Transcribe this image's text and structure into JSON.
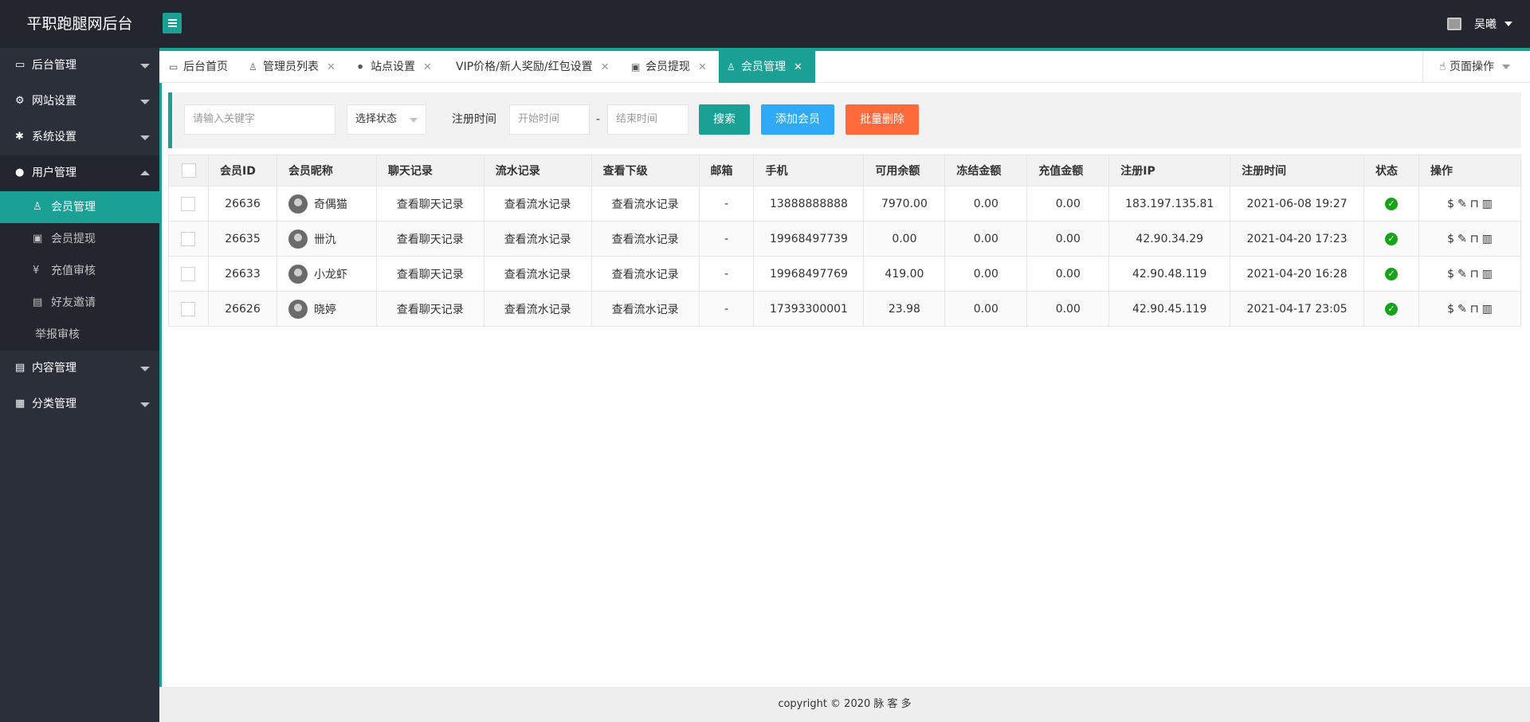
{
  "header": {
    "logo": "平职跑腿网后台",
    "user_name": "吴曦"
  },
  "sidebar": {
    "items": [
      {
        "label": "后台管理",
        "icon": "monitor-icon"
      },
      {
        "label": "网站设置",
        "icon": "gears-icon"
      },
      {
        "label": "系统设置",
        "icon": "gear-icon"
      },
      {
        "label": "用户管理",
        "icon": "users-icon"
      },
      {
        "label": "内容管理",
        "icon": "document-icon"
      },
      {
        "label": "分类管理",
        "icon": "grid-icon"
      }
    ],
    "sub_items": [
      {
        "label": "会员管理",
        "icon": "user-icon"
      },
      {
        "label": "会员提现",
        "icon": "wallet-icon"
      },
      {
        "label": "充值审核",
        "icon": "yen-icon"
      },
      {
        "label": "好友邀请",
        "icon": "gift-icon"
      },
      {
        "label": "举报审核",
        "icon": ""
      }
    ]
  },
  "tabs": [
    {
      "label": "后台首页",
      "icon": "monitor-icon"
    },
    {
      "label": "管理员列表",
      "icon": "user-group-icon"
    },
    {
      "label": "站点设置",
      "icon": "sitemap-icon"
    },
    {
      "label": "VIP价格/新人奖励/红包设置",
      "icon": ""
    },
    {
      "label": "会员提现",
      "icon": "wallet-icon"
    },
    {
      "label": "会员管理",
      "icon": "user-icon"
    }
  ],
  "page_ops": "页面操作",
  "filter": {
    "keyword_placeholder": "请输入关键字",
    "status_select": "选择状态",
    "reg_time_label": "注册时间",
    "start_placeholder": "开始时间",
    "dash": "-",
    "end_placeholder": "结束时间",
    "search_btn": "搜索",
    "add_btn": "添加会员",
    "batch_delete_btn": "批量删除"
  },
  "colors": {
    "accent": "#1aa094",
    "blue": "#2eaaf6",
    "orange": "#ff6a3a",
    "header": "#23262e",
    "sidebar": "#2b2f3a",
    "status_green": "#17a317"
  },
  "table": {
    "headers": [
      "会员ID",
      "会员昵称",
      "聊天记录",
      "流水记录",
      "查看下级",
      "邮箱",
      "手机",
      "可用余额",
      "冻结金额",
      "充值金额",
      "注册IP",
      "注册时间",
      "状态",
      "操作"
    ],
    "rows": [
      {
        "id": "26636",
        "nick": "奇偶猫",
        "chat": "查看聊天记录",
        "flow": "查看流水记录",
        "sub": "查看流水记录",
        "email": "-",
        "phone": "13888888888",
        "balance": "7970.00",
        "frozen": "0.00",
        "recharge": "0.00",
        "ip": "183.197.135.81",
        "time": "2021-06-08 19:27"
      },
      {
        "id": "26635",
        "nick": "卌氿",
        "chat": "查看聊天记录",
        "flow": "查看流水记录",
        "sub": "查看流水记录",
        "email": "-",
        "phone": "19968497739",
        "balance": "0.00",
        "frozen": "0.00",
        "recharge": "0.00",
        "ip": "42.90.34.29",
        "time": "2021-04-20 17:23"
      },
      {
        "id": "26633",
        "nick": "小龙虾",
        "chat": "查看聊天记录",
        "flow": "查看流水记录",
        "sub": "查看流水记录",
        "email": "-",
        "phone": "19968497769",
        "balance": "419.00",
        "frozen": "0.00",
        "recharge": "0.00",
        "ip": "42.90.48.119",
        "time": "2021-04-20 16:28"
      },
      {
        "id": "26626",
        "nick": "晓婷",
        "chat": "查看聊天记录",
        "flow": "查看流水记录",
        "sub": "查看流水记录",
        "email": "-",
        "phone": "17393300001",
        "balance": "23.98",
        "frozen": "0.00",
        "recharge": "0.00",
        "ip": "42.90.45.119",
        "time": "2021-04-17 23:05"
      }
    ]
  },
  "footer": "copyright © 2020 脉 客 多"
}
